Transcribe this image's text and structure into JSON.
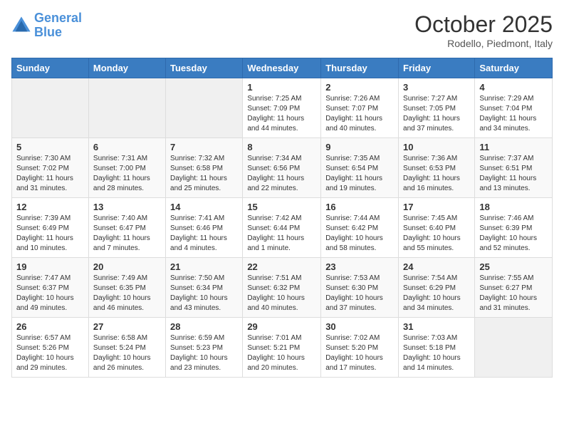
{
  "header": {
    "logo_line1": "General",
    "logo_line2": "Blue",
    "month": "October 2025",
    "location": "Rodello, Piedmont, Italy"
  },
  "days_of_week": [
    "Sunday",
    "Monday",
    "Tuesday",
    "Wednesday",
    "Thursday",
    "Friday",
    "Saturday"
  ],
  "weeks": [
    [
      {
        "day": "",
        "info": ""
      },
      {
        "day": "",
        "info": ""
      },
      {
        "day": "",
        "info": ""
      },
      {
        "day": "1",
        "info": "Sunrise: 7:25 AM\nSunset: 7:09 PM\nDaylight: 11 hours\nand 44 minutes."
      },
      {
        "day": "2",
        "info": "Sunrise: 7:26 AM\nSunset: 7:07 PM\nDaylight: 11 hours\nand 40 minutes."
      },
      {
        "day": "3",
        "info": "Sunrise: 7:27 AM\nSunset: 7:05 PM\nDaylight: 11 hours\nand 37 minutes."
      },
      {
        "day": "4",
        "info": "Sunrise: 7:29 AM\nSunset: 7:04 PM\nDaylight: 11 hours\nand 34 minutes."
      }
    ],
    [
      {
        "day": "5",
        "info": "Sunrise: 7:30 AM\nSunset: 7:02 PM\nDaylight: 11 hours\nand 31 minutes."
      },
      {
        "day": "6",
        "info": "Sunrise: 7:31 AM\nSunset: 7:00 PM\nDaylight: 11 hours\nand 28 minutes."
      },
      {
        "day": "7",
        "info": "Sunrise: 7:32 AM\nSunset: 6:58 PM\nDaylight: 11 hours\nand 25 minutes."
      },
      {
        "day": "8",
        "info": "Sunrise: 7:34 AM\nSunset: 6:56 PM\nDaylight: 11 hours\nand 22 minutes."
      },
      {
        "day": "9",
        "info": "Sunrise: 7:35 AM\nSunset: 6:54 PM\nDaylight: 11 hours\nand 19 minutes."
      },
      {
        "day": "10",
        "info": "Sunrise: 7:36 AM\nSunset: 6:53 PM\nDaylight: 11 hours\nand 16 minutes."
      },
      {
        "day": "11",
        "info": "Sunrise: 7:37 AM\nSunset: 6:51 PM\nDaylight: 11 hours\nand 13 minutes."
      }
    ],
    [
      {
        "day": "12",
        "info": "Sunrise: 7:39 AM\nSunset: 6:49 PM\nDaylight: 11 hours\nand 10 minutes."
      },
      {
        "day": "13",
        "info": "Sunrise: 7:40 AM\nSunset: 6:47 PM\nDaylight: 11 hours\nand 7 minutes."
      },
      {
        "day": "14",
        "info": "Sunrise: 7:41 AM\nSunset: 6:46 PM\nDaylight: 11 hours\nand 4 minutes."
      },
      {
        "day": "15",
        "info": "Sunrise: 7:42 AM\nSunset: 6:44 PM\nDaylight: 11 hours\nand 1 minute."
      },
      {
        "day": "16",
        "info": "Sunrise: 7:44 AM\nSunset: 6:42 PM\nDaylight: 10 hours\nand 58 minutes."
      },
      {
        "day": "17",
        "info": "Sunrise: 7:45 AM\nSunset: 6:40 PM\nDaylight: 10 hours\nand 55 minutes."
      },
      {
        "day": "18",
        "info": "Sunrise: 7:46 AM\nSunset: 6:39 PM\nDaylight: 10 hours\nand 52 minutes."
      }
    ],
    [
      {
        "day": "19",
        "info": "Sunrise: 7:47 AM\nSunset: 6:37 PM\nDaylight: 10 hours\nand 49 minutes."
      },
      {
        "day": "20",
        "info": "Sunrise: 7:49 AM\nSunset: 6:35 PM\nDaylight: 10 hours\nand 46 minutes."
      },
      {
        "day": "21",
        "info": "Sunrise: 7:50 AM\nSunset: 6:34 PM\nDaylight: 10 hours\nand 43 minutes."
      },
      {
        "day": "22",
        "info": "Sunrise: 7:51 AM\nSunset: 6:32 PM\nDaylight: 10 hours\nand 40 minutes."
      },
      {
        "day": "23",
        "info": "Sunrise: 7:53 AM\nSunset: 6:30 PM\nDaylight: 10 hours\nand 37 minutes."
      },
      {
        "day": "24",
        "info": "Sunrise: 7:54 AM\nSunset: 6:29 PM\nDaylight: 10 hours\nand 34 minutes."
      },
      {
        "day": "25",
        "info": "Sunrise: 7:55 AM\nSunset: 6:27 PM\nDaylight: 10 hours\nand 31 minutes."
      }
    ],
    [
      {
        "day": "26",
        "info": "Sunrise: 6:57 AM\nSunset: 5:26 PM\nDaylight: 10 hours\nand 29 minutes."
      },
      {
        "day": "27",
        "info": "Sunrise: 6:58 AM\nSunset: 5:24 PM\nDaylight: 10 hours\nand 26 minutes."
      },
      {
        "day": "28",
        "info": "Sunrise: 6:59 AM\nSunset: 5:23 PM\nDaylight: 10 hours\nand 23 minutes."
      },
      {
        "day": "29",
        "info": "Sunrise: 7:01 AM\nSunset: 5:21 PM\nDaylight: 10 hours\nand 20 minutes."
      },
      {
        "day": "30",
        "info": "Sunrise: 7:02 AM\nSunset: 5:20 PM\nDaylight: 10 hours\nand 17 minutes."
      },
      {
        "day": "31",
        "info": "Sunrise: 7:03 AM\nSunset: 5:18 PM\nDaylight: 10 hours\nand 14 minutes."
      },
      {
        "day": "",
        "info": ""
      }
    ]
  ]
}
